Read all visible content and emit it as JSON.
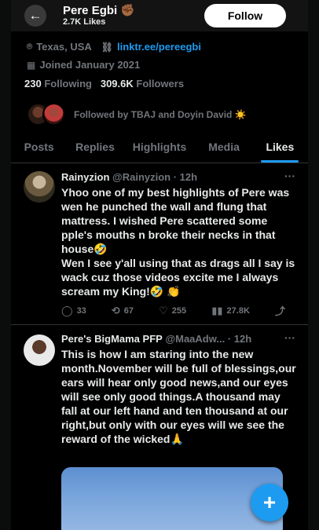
{
  "header": {
    "name": "Pere Egbi",
    "name_emoji": "✊🏾",
    "likes_count": "2.7K Likes",
    "follow_label": "Follow"
  },
  "profile": {
    "location": "Texas, USA",
    "link": "linktr.ee/pereegbi",
    "joined": "Joined January 2021",
    "following_count": "230",
    "following_label": "Following",
    "followers_count": "309.6K",
    "followers_label": "Followers",
    "followed_by": "Followed by TBAJ and Doyin David ☀️"
  },
  "tabs": [
    "Posts",
    "Replies",
    "Highlights",
    "Media",
    "Likes"
  ],
  "active_tab": "Likes",
  "tweets": [
    {
      "name": "Rainyzion",
      "handle": "@Rainyzion",
      "time": "· 12h",
      "text": "Yhoo one of my best highlights of Pere was wen he punched the wall and flung that mattress. I wished Pere scattered some pple's mouths n broke their necks in that house🤣\nWen I see y'all using that as drags all I say is wack cuz those videos excite me I always scream my King!🤣 👏",
      "replies": "33",
      "reposts": "67",
      "likes": "255",
      "views": "27.8K"
    },
    {
      "name": "Pere's BigMama PFP",
      "handle": "@MaaAdw...",
      "time": "· 12h",
      "text": "This is how I am staring into the new month.November will be full of blessings,our ears will hear only good news,and our eyes will see only good things.A thousand may fall at our left hand and ten thousand at our right,but only with our eyes will we see the reward of the wicked🙏"
    }
  ],
  "colors": {
    "accent": "#1d9bf0",
    "background": "#000000",
    "muted": "#71767b"
  },
  "icons": {
    "back": "←",
    "location": "⌾",
    "link": "🔗",
    "calendar": "▦",
    "reply": "💬",
    "repost": "⟲",
    "like": "♡",
    "views": "📊",
    "share": "⤴",
    "more": "···",
    "compose": "+"
  }
}
